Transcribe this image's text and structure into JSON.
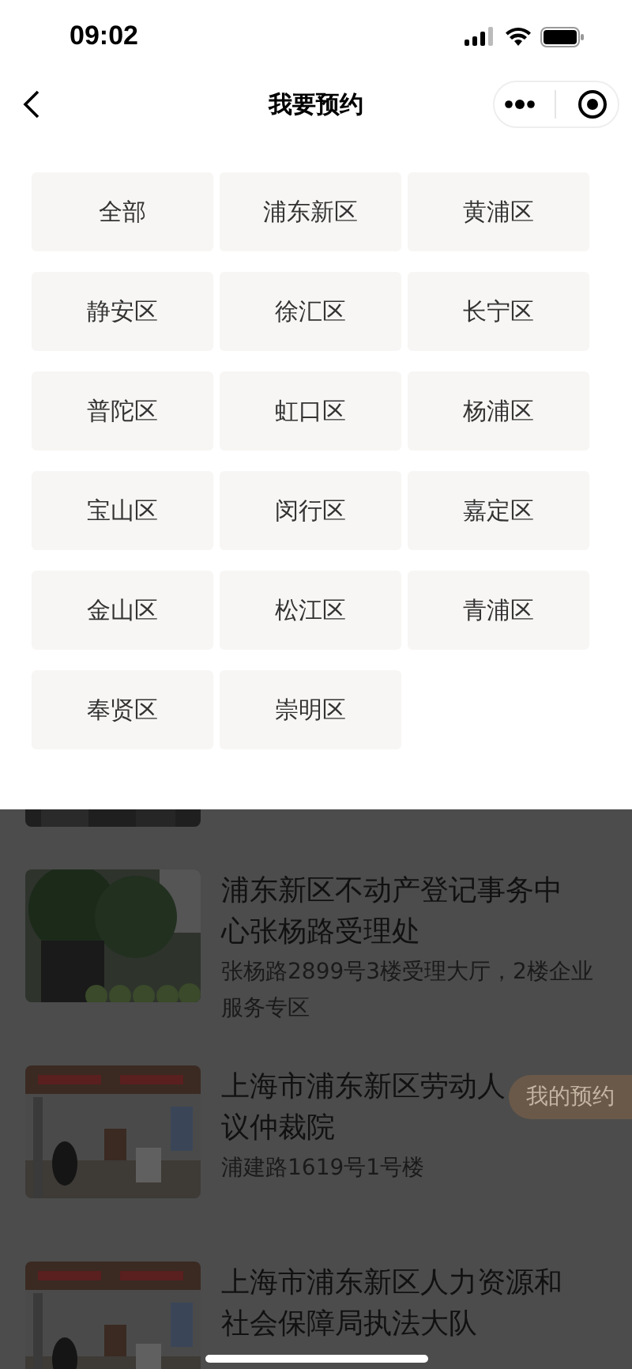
{
  "status_bar": {
    "time": "09:02"
  },
  "nav": {
    "title": "我要预约"
  },
  "districts": [
    {
      "label": "全部",
      "selected": false
    },
    {
      "label": "浦东新区",
      "selected": false
    },
    {
      "label": "黄浦区",
      "selected": false
    },
    {
      "label": "静安区",
      "selected": false
    },
    {
      "label": "徐汇区",
      "selected": false
    },
    {
      "label": "长宁区",
      "selected": false
    },
    {
      "label": "普陀区",
      "selected": false
    },
    {
      "label": "虹口区",
      "selected": false
    },
    {
      "label": "杨浦区",
      "selected": false
    },
    {
      "label": "宝山区",
      "selected": false
    },
    {
      "label": "闵行区",
      "selected": false
    },
    {
      "label": "嘉定区",
      "selected": false
    },
    {
      "label": "金山区",
      "selected": false
    },
    {
      "label": "松江区",
      "selected": false
    },
    {
      "label": "青浦区",
      "selected": false
    },
    {
      "label": "奉贤区",
      "selected": false
    },
    {
      "label": "崇明区",
      "selected": false
    }
  ],
  "offices": [
    {
      "title_lines": [
        "浦东新区不动产登记事务中",
        "心张杨路受理处"
      ],
      "address": "张杨路2899号3楼受理大厅，2楼企业服务专区",
      "image": {
        "kind": "picture"
      }
    },
    {
      "title_lines": [
        "上海市浦东新区劳动人",
        "议仲裁院"
      ],
      "address": "浦建路1619号1号楼",
      "image": {
        "kind": "picture"
      }
    },
    {
      "title_lines": [
        "上海市浦东新区人力资源和",
        "社会保障局执法大队"
      ],
      "image": {
        "kind": "picture"
      }
    }
  ],
  "floating_button": {
    "label": "我的预约"
  }
}
